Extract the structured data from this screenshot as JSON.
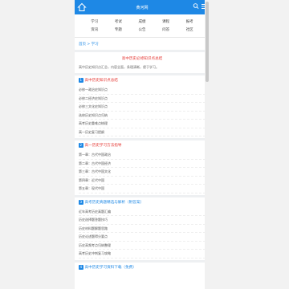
{
  "header": {
    "title": "黄河网"
  },
  "nav": {
    "items": [
      "学习",
      "考试",
      "成绩",
      "课程",
      "报考",
      "资讯",
      "专题",
      "公告",
      "问答",
      "社区"
    ]
  },
  "breadcrumb": "首页 > 学习",
  "hero": {
    "title": "高中历史必修知识点总结",
    "desc": "高中历史知识点汇总，内容全面，条理清晰，便于学习。"
  },
  "sections": [
    {
      "badge": "1",
      "title": "高中历史知识点总结",
      "title_color": "red",
      "items": [
        "必修一政治史知识点",
        "必修二经济史知识点",
        "必修三文化史知识点",
        "选修历史知识点归纳",
        "高考历史重难点梳理",
        "高一历史复习提纲"
      ]
    },
    {
      "badge": "2",
      "title": "高一历史学习方法指导",
      "title_color": "red",
      "items": [
        "第一章：古代中国政治",
        "第二章：古代中国经济",
        "第三章：古代中国文化",
        "第四章：近代中国",
        "第五章：现代中国"
      ]
    },
    {
      "badge": "3",
      "title": "高考历史真题精选与解析（附答案）",
      "title_color": "blue",
      "items": [
        "近年高考历史真题汇编",
        "历史选择题答题技巧",
        "历史材料题解题思路",
        "历史论述题得分要点",
        "历史高频考点归纳整理",
        "高考历史冲刺复习攻略"
      ]
    },
    {
      "badge": "4",
      "title": "高中历史学习资料下载（免费）",
      "title_color": "blue",
      "items": []
    }
  ],
  "colors": {
    "accent": "#1e88e5",
    "highlight": "#e53935"
  }
}
